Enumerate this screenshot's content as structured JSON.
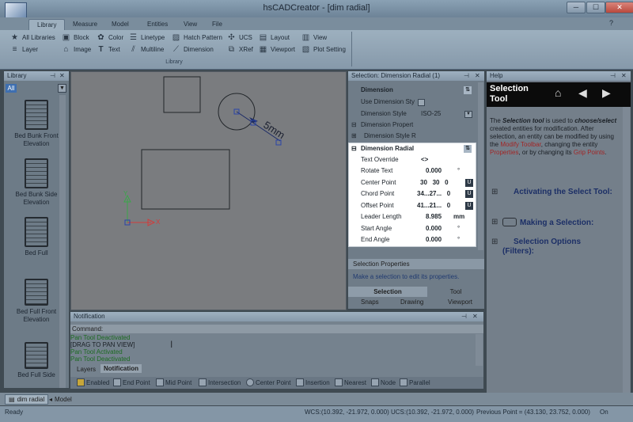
{
  "window": {
    "title": "hsCADCreator - [dim radial]"
  },
  "ribbon": {
    "tabs": [
      "Library",
      "Measure",
      "Model",
      "Entities",
      "View",
      "File"
    ],
    "group_label": "Library",
    "items": {
      "all_libraries": "All Libraries",
      "layer": "Layer",
      "block": "Block",
      "image": "Image",
      "color": "Color",
      "text": "Text",
      "linetype": "Linetype",
      "multiline": "Multiline",
      "hatch_pattern": "Hatch Pattern",
      "dimension": "Dimension",
      "ucs": "UCS",
      "xref": "XRef",
      "layout": "Layout",
      "viewport": "Viewport",
      "view": "View",
      "plot_setting": "Plot Setting"
    }
  },
  "library": {
    "title": "Library",
    "filter": "All",
    "items": [
      "Bed Bunk Front Elevation",
      "Bed Bunk Side Elevation",
      "Bed Full",
      "Bed Full Front Elevation",
      "Bed Full Side"
    ]
  },
  "canvas": {
    "dimension_text": "5mm",
    "axis_y": "Y",
    "axis_x": "X"
  },
  "selection": {
    "title": "Selection: Dimension Radial (1)",
    "rows": {
      "dimension": "Dimension",
      "use_dimension_style": "Use Dimension Sty",
      "dimension_style": "Dimension Style",
      "dimension_style_value": "ISO-25",
      "dimension_properties": "Dimension Propert",
      "dimension_style_r": "Dimension Style R",
      "dimension_radial": "Dimension Radial",
      "text_override": "Text Override",
      "text_override_value": "<>",
      "rotate_text": "Rotate Text",
      "rotate_text_value": "0.000",
      "center_point": "Center Point",
      "center_point_value": "30   30   0",
      "chord_point": "Chord Point",
      "chord_point_value": "34...27...   0",
      "offset_point": "Offset Point",
      "offset_point_value": "41...21...   0",
      "leader_length": "Leader Length",
      "leader_length_value": "8.985",
      "leader_unit": "mm",
      "start_angle": "Start Angle",
      "start_angle_value": "0.000",
      "end_angle": "End Angle",
      "end_angle_value": "0.000",
      "degree": "°"
    },
    "props_title": "Selection Properties",
    "props_hint": "Make a selection to edit its properties.",
    "tabs": [
      "Selection",
      "Tool"
    ],
    "subtabs": [
      "Snaps",
      "Drawing",
      "Viewport"
    ]
  },
  "help": {
    "title": "Help",
    "heading": "Selection Tool",
    "para_1": "The",
    "para_bold_1": "Selection tool",
    "para_2": "is used to",
    "para_bold_2": "choose/select",
    "para_3": "created entities for modification. After selection, an entity can be modified by using the",
    "link_1": "Modify Toolbar",
    "para_4": ", changing the entity",
    "link_2": "Properties",
    "para_5": ", or by changing its",
    "link_3": "Grip Points",
    "para_6": ".",
    "sections": [
      "Activating the Select Tool:",
      "Making a Selection:",
      "Selection Options (Filters):"
    ]
  },
  "notification": {
    "title": "Notification",
    "command_label": "Command:",
    "lines": [
      "Pan Tool Deactivated",
      "[DRAG TO PAN VIEW]",
      "Pan Tool Activated",
      "Pan Tool Deactivated"
    ],
    "tabs": [
      "Layers",
      "Notification"
    ]
  },
  "snaps": [
    "Enabled",
    "End Point",
    "Mid Point",
    "Intersection",
    "Center Point",
    "Insertion",
    "Nearest",
    "Node",
    "Parallel"
  ],
  "doctabs": [
    "dim radial",
    "Model"
  ],
  "status": {
    "ready": "Ready",
    "wcs": "WCS:(10.392, -21.972, 0.000)",
    "ucs": "UCS:(10.392, -21.972, 0.000)",
    "previous": "Previous Point = (43.130, 23.752, 0.000)",
    "on": "On"
  }
}
